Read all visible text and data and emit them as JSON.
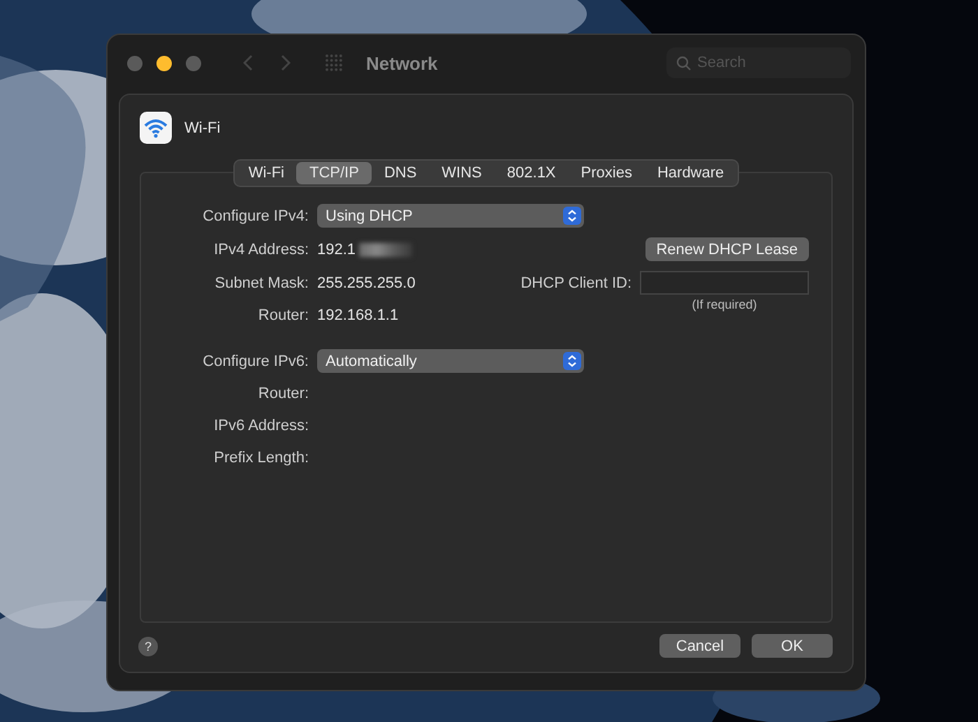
{
  "window": {
    "title": "Network",
    "search": {
      "placeholder": "Search"
    }
  },
  "traffic_lights": [
    {
      "color": "#5a5a5a"
    },
    {
      "color": "#febc2e"
    },
    {
      "color": "#5a5a5a"
    }
  ],
  "service": {
    "name": "Wi-Fi"
  },
  "tabs": [
    {
      "label": "Wi-Fi",
      "selected": false
    },
    {
      "label": "TCP/IP",
      "selected": true
    },
    {
      "label": "DNS",
      "selected": false
    },
    {
      "label": "WINS",
      "selected": false
    },
    {
      "label": "802.1X",
      "selected": false
    },
    {
      "label": "Proxies",
      "selected": false
    },
    {
      "label": "Hardware",
      "selected": false
    }
  ],
  "sections": [
    {
      "rows": [
        {
          "kind": "select",
          "label": "Configure IPv4:",
          "value": "Using DHCP"
        },
        {
          "kind": "text",
          "label": "IPv4 Address:",
          "value": "192.1",
          "redacted": true,
          "aside": {
            "kind": "button",
            "label": "Renew DHCP Lease"
          }
        },
        {
          "kind": "text",
          "label": "Subnet Mask:",
          "value": "255.255.255.0",
          "aside": {
            "kind": "field",
            "label": "DHCP Client ID:",
            "note": "(If required)"
          }
        },
        {
          "kind": "text",
          "label": "Router:",
          "value": "192.168.1.1"
        }
      ]
    },
    {
      "rows": [
        {
          "kind": "select",
          "label": "Configure IPv6:",
          "value": "Automatically"
        },
        {
          "kind": "text",
          "label": "Router:"
        },
        {
          "kind": "text",
          "label": "IPv6 Address:"
        },
        {
          "kind": "text",
          "label": "Prefix Length:"
        }
      ]
    }
  ],
  "help": "?",
  "buttons": [
    "Cancel",
    "OK"
  ]
}
